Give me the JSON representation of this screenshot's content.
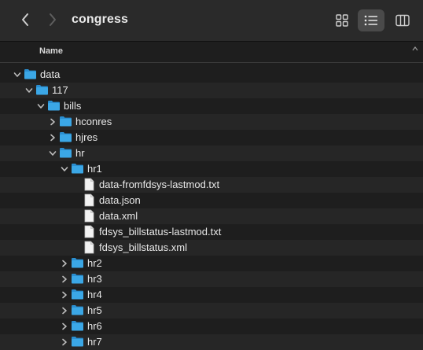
{
  "window": {
    "title": "congress",
    "column_name_header": "Name"
  },
  "toolbar": {
    "back_icon": "chevron-left-icon",
    "forward_icon": "chevron-right-icon",
    "grid_view_icon": "grid-view-icon",
    "list_view_icon": "list-view-icon",
    "column_view_icon": "column-view-icon"
  },
  "colors": {
    "folder": "#3ba7e6",
    "folder_dark": "#2a8ed0",
    "selected_view_bg": "#4a4a4a"
  },
  "rows": [
    {
      "name": "data",
      "type": "folder",
      "depth": 0,
      "expanded": true
    },
    {
      "name": "117",
      "type": "folder",
      "depth": 1,
      "expanded": true
    },
    {
      "name": "bills",
      "type": "folder",
      "depth": 2,
      "expanded": true
    },
    {
      "name": "hconres",
      "type": "folder",
      "depth": 3,
      "expanded": false
    },
    {
      "name": "hjres",
      "type": "folder",
      "depth": 3,
      "expanded": false
    },
    {
      "name": "hr",
      "type": "folder",
      "depth": 3,
      "expanded": true
    },
    {
      "name": "hr1",
      "type": "folder",
      "depth": 4,
      "expanded": true
    },
    {
      "name": "data-fromfdsys-lastmod.txt",
      "type": "file",
      "depth": 5
    },
    {
      "name": "data.json",
      "type": "file",
      "depth": 5
    },
    {
      "name": "data.xml",
      "type": "file",
      "depth": 5
    },
    {
      "name": "fdsys_billstatus-lastmod.txt",
      "type": "file",
      "depth": 5
    },
    {
      "name": "fdsys_billstatus.xml",
      "type": "file",
      "depth": 5
    },
    {
      "name": "hr2",
      "type": "folder",
      "depth": 4,
      "expanded": false
    },
    {
      "name": "hr3",
      "type": "folder",
      "depth": 4,
      "expanded": false
    },
    {
      "name": "hr4",
      "type": "folder",
      "depth": 4,
      "expanded": false
    },
    {
      "name": "hr5",
      "type": "folder",
      "depth": 4,
      "expanded": false
    },
    {
      "name": "hr6",
      "type": "folder",
      "depth": 4,
      "expanded": false
    },
    {
      "name": "hr7",
      "type": "folder",
      "depth": 4,
      "expanded": false
    }
  ]
}
